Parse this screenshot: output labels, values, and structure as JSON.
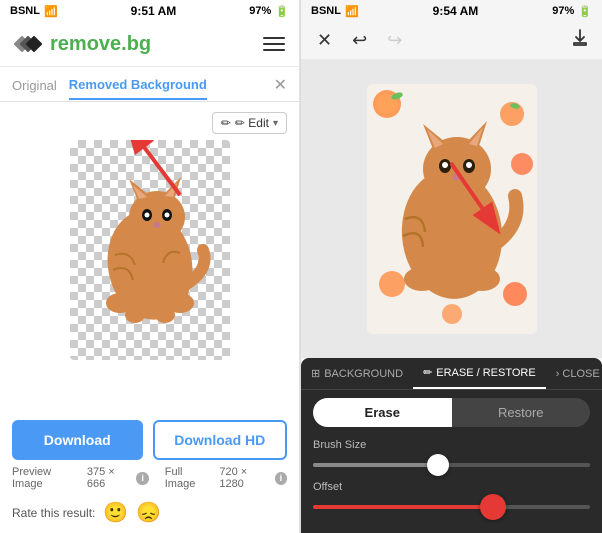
{
  "left": {
    "statusBar": {
      "carrier": "BSNL",
      "time": "9:51 AM",
      "battery": "97%"
    },
    "nav": {
      "logoText": "remove",
      "logoAccent": "bg"
    },
    "tabs": {
      "original": "Original",
      "removed": "Removed Background"
    },
    "editBtn": "✏ Edit",
    "buttons": {
      "download": "Download",
      "downloadHd": "Download HD"
    },
    "info": {
      "preview": {
        "label": "Preview Image",
        "size": "375 × 666"
      },
      "full": {
        "label": "Full Image",
        "size": "720 × 1280"
      }
    },
    "rating": {
      "label": "Rate this result:"
    }
  },
  "right": {
    "statusBar": {
      "carrier": "BSNL",
      "time": "9:54 AM",
      "battery": "97%"
    },
    "tabs": {
      "background": "BACKGROUND",
      "eraseRestore": "ERASE / RESTORE",
      "close": "CLOSE"
    },
    "eraseRestoreButtons": {
      "erase": "Erase",
      "restore": "Restore"
    },
    "sliders": {
      "brushSize": "Brush Size",
      "offset": "Offset"
    }
  }
}
